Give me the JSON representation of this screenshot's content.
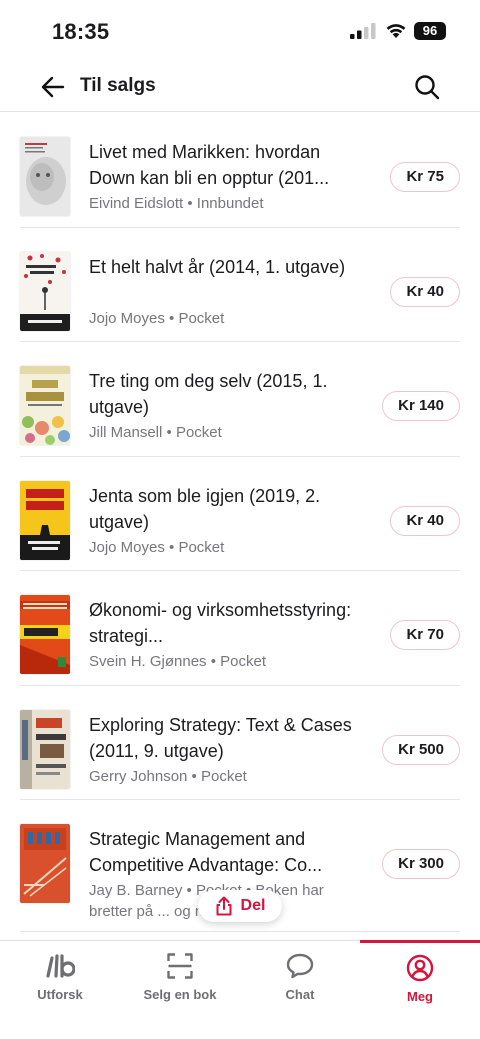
{
  "status_bar": {
    "time": "18:35",
    "battery": "96"
  },
  "header": {
    "title": "Til salgs"
  },
  "listings": [
    {
      "title": "Livet med Marikken: hvordan Down kan bli en opptur (201...",
      "meta": "Eivind Eidslott • Innbundet",
      "price": "Kr 75"
    },
    {
      "title": "Et helt halvt år (2014, 1. utgave)",
      "meta": "Jojo Moyes • Pocket",
      "price": "Kr 40"
    },
    {
      "title": "Tre ting om deg selv (2015, 1. utgave)",
      "meta": "Jill Mansell • Pocket",
      "price": "Kr 140"
    },
    {
      "title": "Jenta som ble igjen (2019, 2. utgave)",
      "meta": "Jojo Moyes • Pocket",
      "price": "Kr 40"
    },
    {
      "title": "Økonomi- og virksomhetsstyring: strategi...",
      "meta": "Svein H. Gjønnes • Pocket",
      "price": "Kr 70"
    },
    {
      "title": "Exploring Strategy: Text & Cases (2011, 9. utgave)",
      "meta": "Gerry Johnson • Pocket",
      "price": "Kr 500"
    },
    {
      "title": "Strategic Management and Competitive Advantage: Co...",
      "meta": "Jay B. Barney • Pocket • Boken har bretter på ... og no...",
      "price": "Kr 300"
    }
  ],
  "share_button": {
    "label": "Del"
  },
  "tabs": [
    {
      "label": "Utforsk",
      "icon": "explore-icon"
    },
    {
      "label": "Selg en bok",
      "icon": "scan-icon"
    },
    {
      "label": "Chat",
      "icon": "chat-icon"
    },
    {
      "label": "Meg",
      "icon": "profile-icon"
    }
  ],
  "colors": {
    "accent": "#d6143e",
    "text": "#1c1c1e",
    "muted": "#76767d",
    "divider": "#e6e6ea"
  }
}
